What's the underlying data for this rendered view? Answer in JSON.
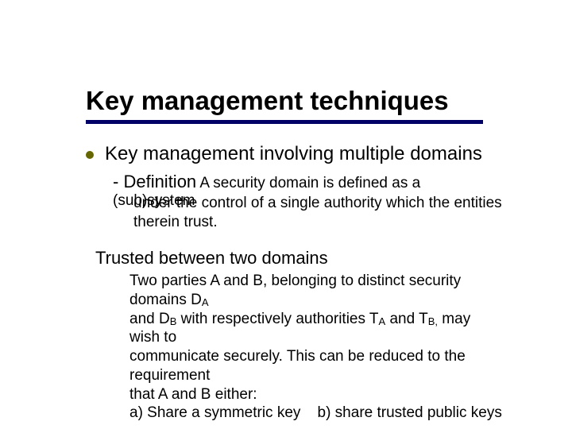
{
  "title": "Key management techniques",
  "bullet": "Key management involving multiple domains",
  "dash_label": "Definition",
  "dash_body_first": " A security domain is defined as a (sub)system",
  "dash_body_rest": "under the control of a single authority which the entities therein trust.",
  "trusted_heading": "Trusted between two domains",
  "para_line1_a": "Two parties A and B, belonging to distinct security domains D",
  "para_line1_b": "A",
  "para_line2_a": "and D",
  "para_line2_b": "B",
  "para_line2_c": " with respectively authorities T",
  "para_line2_d": "A",
  "para_line2_e": " and T",
  "para_line2_f": "B,",
  "para_line2_g": " may wish to",
  "para_line3": "communicate securely. This can be reduced to the requirement",
  "para_line4": "that A and B either:",
  "para_line5": "a) Share a symmetric key    b) share trusted public keys"
}
